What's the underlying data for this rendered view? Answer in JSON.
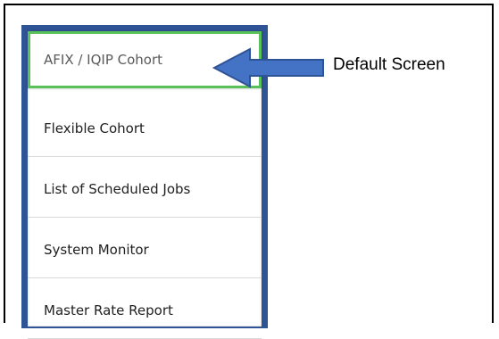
{
  "menu": {
    "items": [
      {
        "label": "AFIX / IQIP Cohort",
        "active": true
      },
      {
        "label": "Flexible Cohort",
        "active": false
      },
      {
        "label": "List of Scheduled Jobs",
        "active": false
      },
      {
        "label": "System Monitor",
        "active": false
      },
      {
        "label": "Master Rate Report",
        "active": false
      }
    ]
  },
  "annotation": {
    "text": "Default Screen",
    "arrow_color": "#4472c4",
    "arrow_border": "#2f5496"
  },
  "colors": {
    "sidebar_border": "#2f5496",
    "active_highlight": "#5ac15a"
  }
}
